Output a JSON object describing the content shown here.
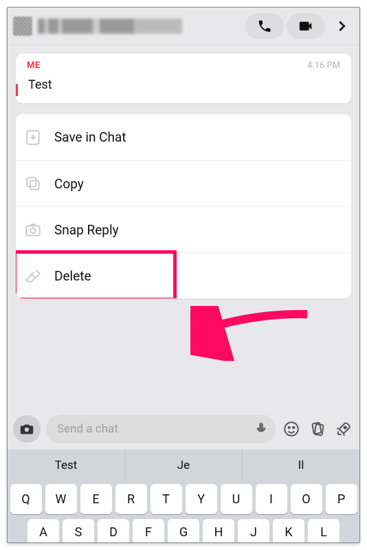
{
  "header": {
    "avatar_alt": "contact-avatar",
    "name_redacted": true
  },
  "message": {
    "sender_label": "ME",
    "time": "4:16 PM",
    "text": "Test"
  },
  "menu": {
    "save": "Save in Chat",
    "copy": "Copy",
    "snap_reply": "Snap Reply",
    "delete": "Delete"
  },
  "composer": {
    "placeholder": "Send a chat"
  },
  "keyboard": {
    "suggestions": [
      "Test",
      "Je",
      "Il"
    ],
    "row1": [
      "Q",
      "W",
      "E",
      "R",
      "T",
      "Y",
      "U",
      "I",
      "O",
      "P"
    ],
    "row2": [
      "A",
      "S",
      "D",
      "F",
      "G",
      "H",
      "J",
      "K",
      "L"
    ]
  },
  "colors": {
    "accent": "#ff3040",
    "highlight": "#ff0a60"
  }
}
